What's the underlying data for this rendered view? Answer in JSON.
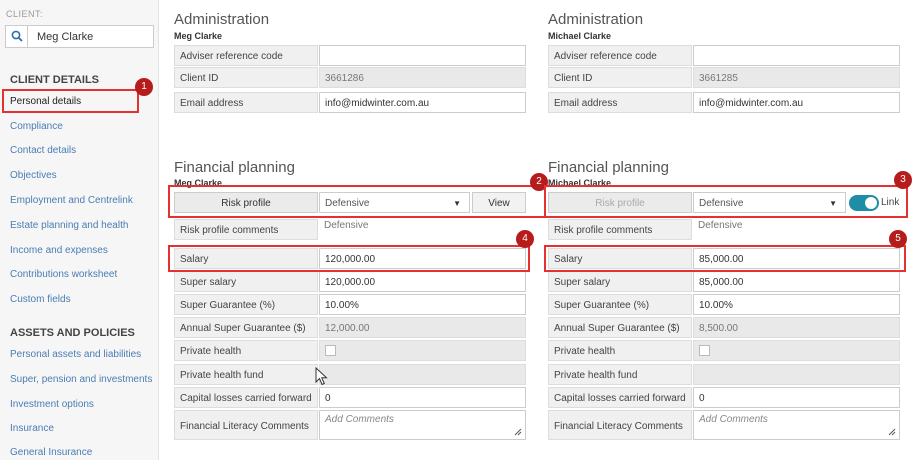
{
  "sidebar": {
    "client_label": "CLIENT:",
    "search_value": "Meg Clarke",
    "client_details_heading": "CLIENT DETAILS",
    "client_items": [
      "Personal details",
      "Compliance",
      "Contact details",
      "Objectives",
      "Employment and Centrelink",
      "Estate planning and health",
      "Income and expenses",
      "Contributions worksheet",
      "Custom fields"
    ],
    "assets_heading": "ASSETS AND POLICIES",
    "asset_items": [
      "Personal assets and liabilities",
      "Super, pension and investments",
      "Investment options",
      "Insurance",
      "General Insurance"
    ]
  },
  "labels": {
    "admin_title": "Administration",
    "fp_title": "Financial planning",
    "adviser_ref": "Adviser reference code",
    "client_id": "Client ID",
    "email": "Email address",
    "risk_profile_btn": "Risk profile",
    "risk_comments": "Risk profile comments",
    "salary": "Salary",
    "super_salary": "Super salary",
    "super_guarantee": "Super Guarantee (%)",
    "annual_sg": "Annual Super Guarantee ($)",
    "private_health": "Private health",
    "private_health_fund": "Private health fund",
    "capital_losses": "Capital losses carried forward",
    "fin_literacy": "Financial Literacy Comments",
    "add_comments": "Add Comments",
    "view_btn": "View",
    "link_label": "Link"
  },
  "left": {
    "name": "Meg Clarke",
    "adviser_ref": "",
    "client_id": "3661286",
    "email": "info@midwinter.com.au",
    "risk_profile": "Defensive",
    "risk_comments": "Defensive",
    "salary": "120,000.00",
    "super_salary": "120,000.00",
    "super_guarantee": "10.00%",
    "annual_sg": "12,000.00",
    "capital_losses": "0"
  },
  "right": {
    "name": "Michael Clarke",
    "adviser_ref": "",
    "client_id": "3661285",
    "email": "info@midwinter.com.au",
    "risk_profile": "Defensive",
    "risk_comments": "Defensive",
    "salary": "85,000.00",
    "super_salary": "85,000.00",
    "super_guarantee": "10.00%",
    "annual_sg": "8,500.00",
    "capital_losses": "0"
  },
  "badges": [
    "1",
    "2",
    "3",
    "4",
    "5"
  ],
  "colors": {
    "annotation_red": "#e5312f",
    "badge_red": "#b71c1c",
    "toggle_teal": "#1d8ea5",
    "link_blue": "#4a7db4"
  }
}
